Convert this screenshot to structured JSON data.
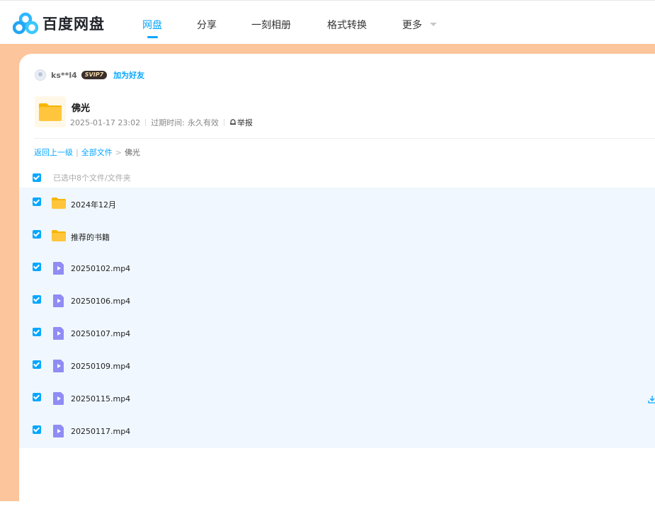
{
  "brand": {
    "name": "百度网盘"
  },
  "nav": {
    "items": [
      {
        "label": "网盘",
        "active": true
      },
      {
        "label": "分享",
        "active": false
      },
      {
        "label": "一刻相册",
        "active": false
      },
      {
        "label": "格式转换",
        "active": false
      },
      {
        "label": "更多",
        "active": false
      }
    ]
  },
  "share": {
    "username": "ks**l4",
    "vip_badge": "SVIP7",
    "add_friend_label": "加为好友",
    "title": "佛光",
    "date": "2025-01-17 23:02",
    "expiry_label": "过期时间:",
    "expiry_value": "永久有效",
    "report_label": "举报"
  },
  "breadcrumb": {
    "back": "返回上一级",
    "all_files": "全部文件",
    "separator": ">",
    "current": "佛光"
  },
  "selection": {
    "text": "已选中8个文件/文件夹",
    "checked": true
  },
  "files": [
    {
      "name": "2024年12月",
      "type": "folder",
      "checked": true
    },
    {
      "name": "推荐的书籍",
      "type": "folder",
      "checked": true
    },
    {
      "name": "20250102.mp4",
      "type": "video",
      "checked": true
    },
    {
      "name": "20250106.mp4",
      "type": "video",
      "checked": true
    },
    {
      "name": "20250107.mp4",
      "type": "video",
      "checked": true
    },
    {
      "name": "20250109.mp4",
      "type": "video",
      "checked": true
    },
    {
      "name": "20250115.mp4",
      "type": "video",
      "checked": true
    },
    {
      "name": "20250117.mp4",
      "type": "video",
      "checked": true
    }
  ],
  "colors": {
    "accent": "#06a7ff",
    "page_bg": "#fcc59c",
    "list_bg": "#f0f7fe",
    "folder": "#ffc53d",
    "video": "#8f8cf4"
  }
}
